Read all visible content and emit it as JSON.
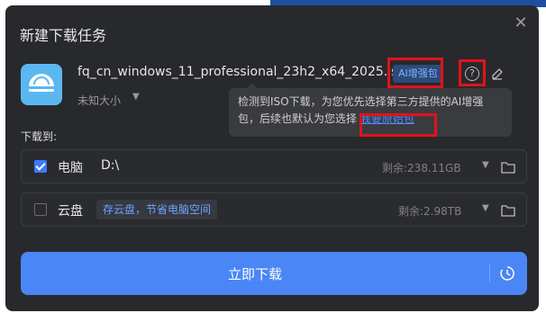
{
  "background": {
    "partial_text": "…"
  },
  "dialog": {
    "title": "新建下载任务",
    "close_glyph": "✕",
    "file": {
      "name": "fq_cn_windows_11_professional_23h2_x64_2025.iso",
      "ai_badge": "AI增强包",
      "size_label": "未知大小",
      "icon": "disc-file-icon",
      "help_icon": "?",
      "edit_icon": "edit-icon"
    },
    "tooltip": {
      "text": "检测到ISO下载，为您优先选择第三方提供的AI增强包，后续也默认为您选择",
      "link": "我要原始包"
    },
    "download_to_label": "下载到:",
    "destinations": [
      {
        "name": "电脑",
        "path": "D:\\",
        "free": "剩余:238.11GB",
        "checked": true
      },
      {
        "name": "云盘",
        "hint": "存云盘，节省电脑空间",
        "free": "剩余:2.98TB",
        "checked": false
      }
    ],
    "download_button": {
      "label": "立即下载",
      "icon": "schedule-clock-icon"
    }
  },
  "colors": {
    "dialog_bg": "#28292c",
    "accent": "#4a86f5",
    "highlight_box": "#e2121b",
    "link": "#4f8bff"
  }
}
